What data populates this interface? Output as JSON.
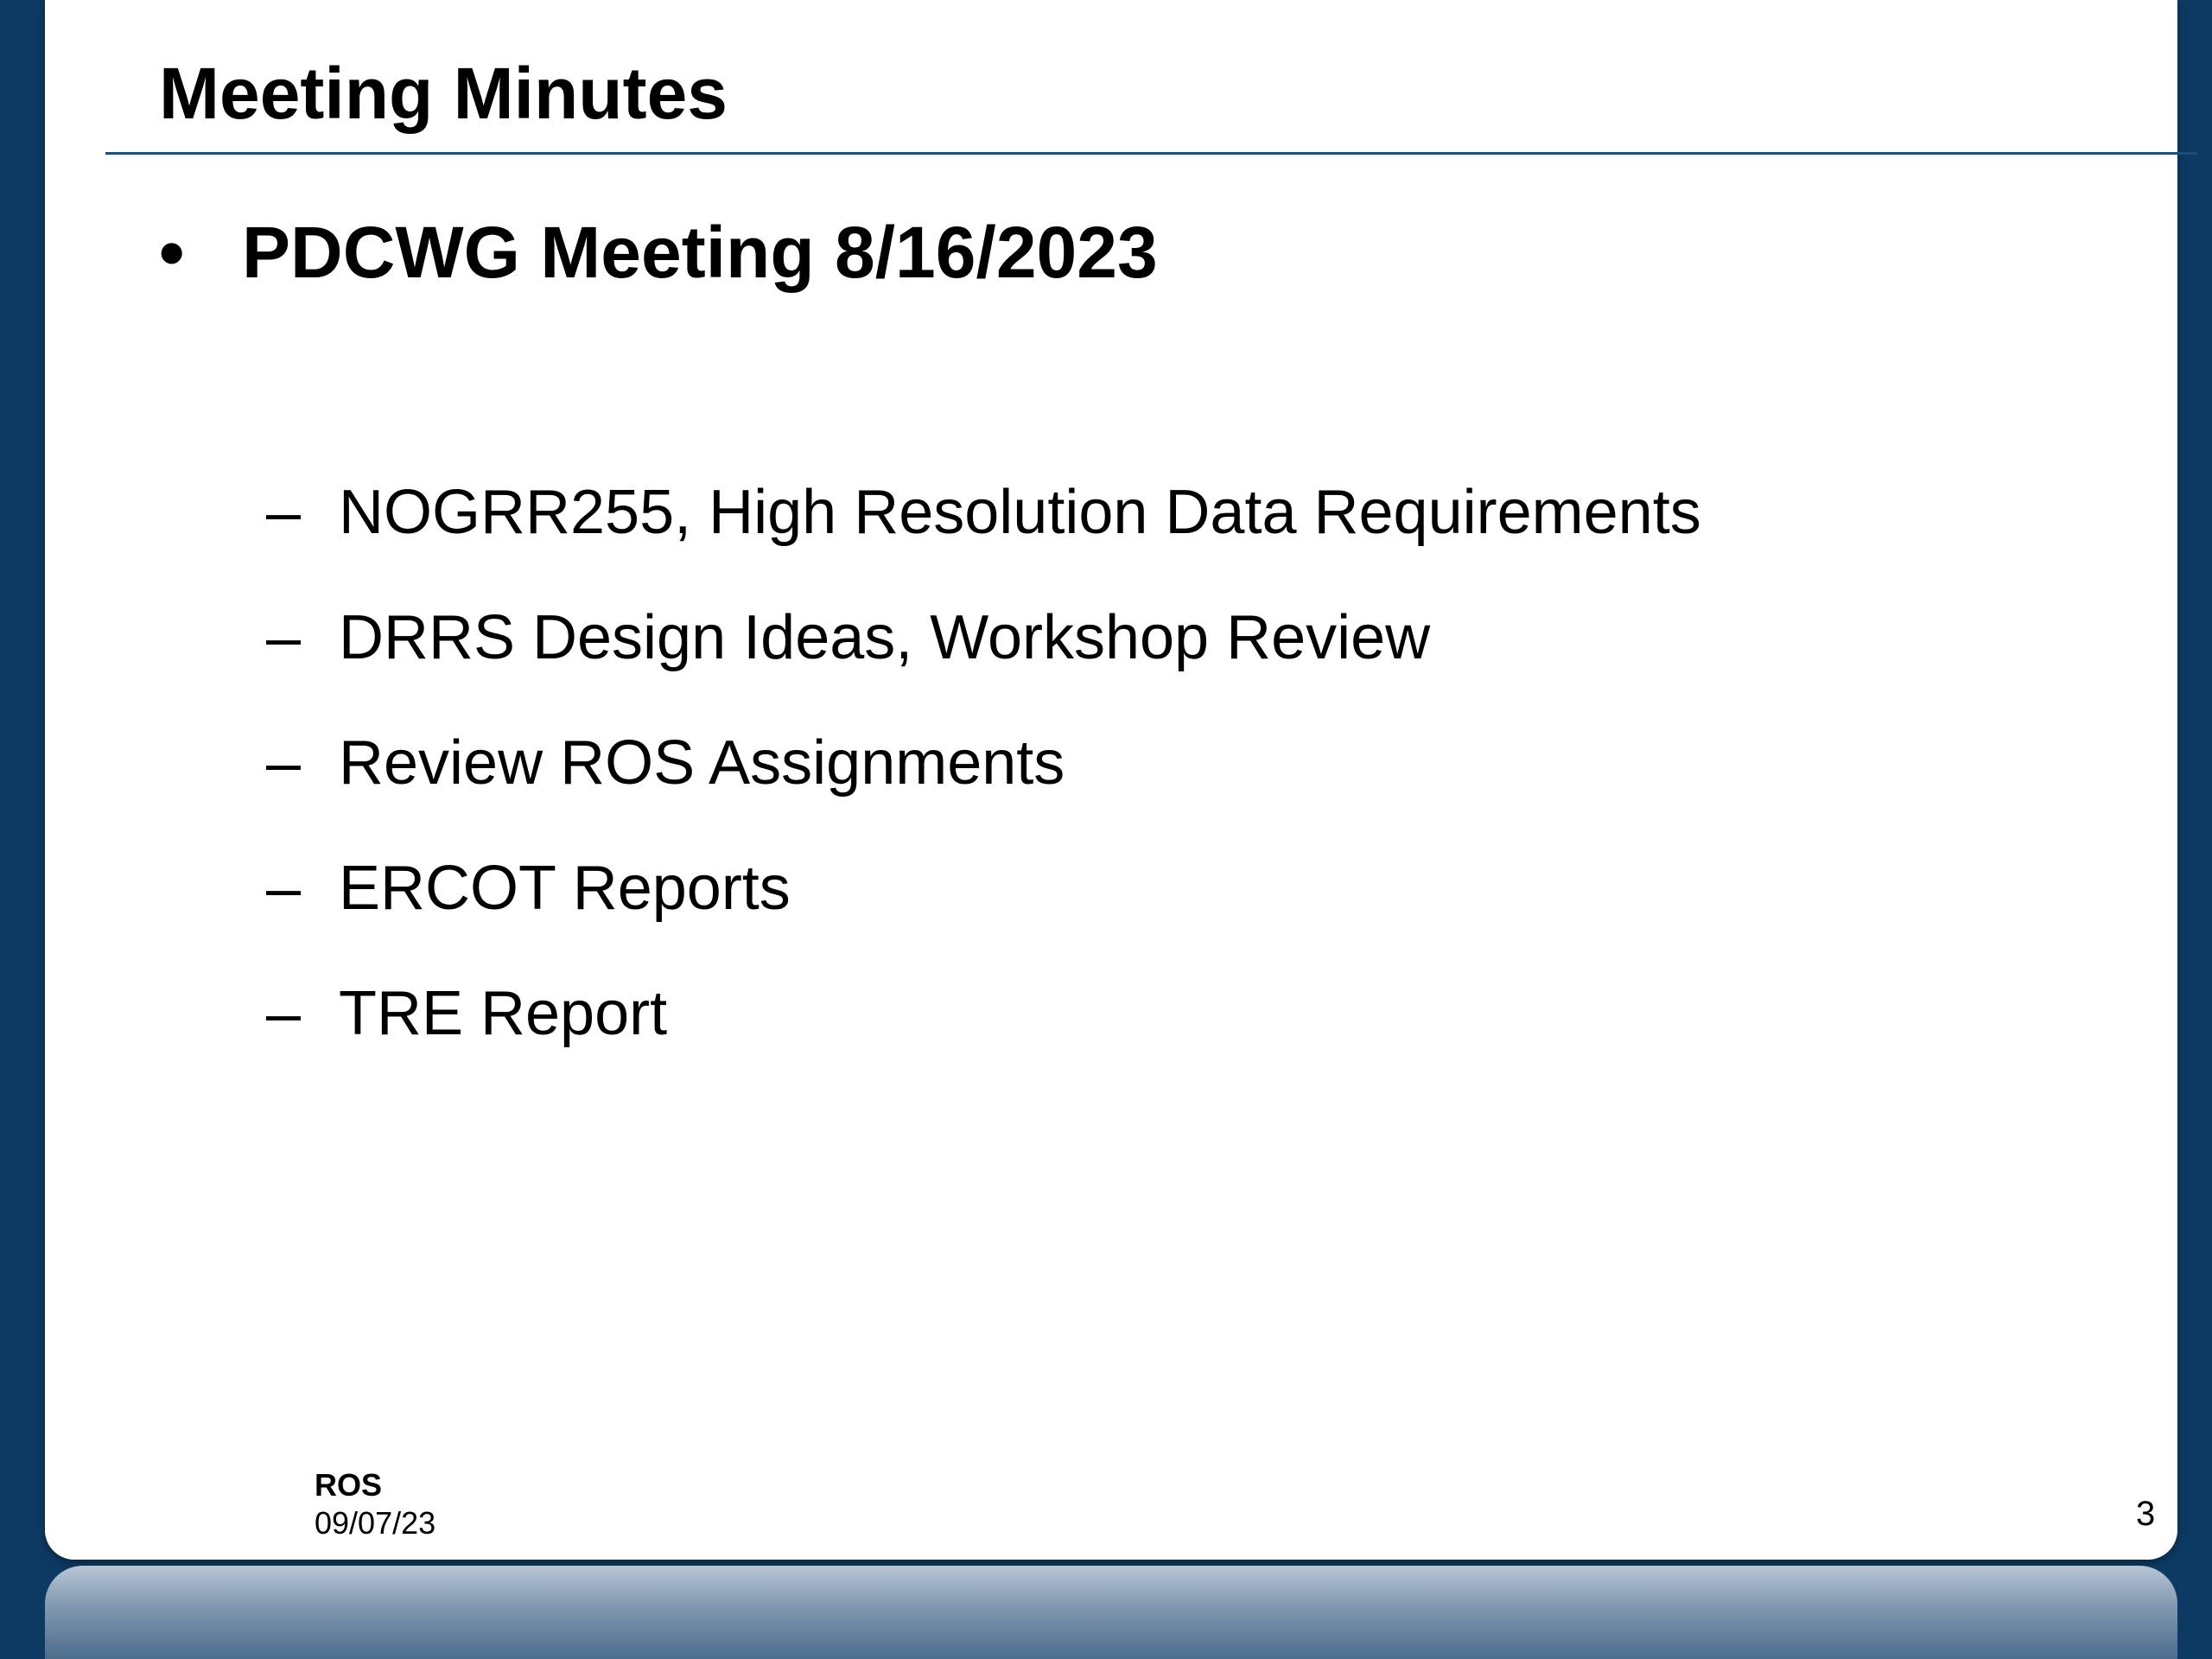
{
  "slide": {
    "title": "Meeting Minutes",
    "bullet_symbol": "•",
    "heading": "PDCWG Meeting 8/16/2023",
    "dash_symbol": "–",
    "items": [
      "NOGRR255, High Resolution Data Requirements",
      "DRRS Design Ideas, Workshop Review",
      "Review ROS Assignments",
      "ERCOT Reports",
      "TRE Report"
    ]
  },
  "footer": {
    "org": "ROS",
    "date": "09/07/23",
    "page_number": "3"
  },
  "colors": {
    "background": "#0d3a63",
    "rule": "#1d4e7a",
    "card": "#ffffff"
  }
}
